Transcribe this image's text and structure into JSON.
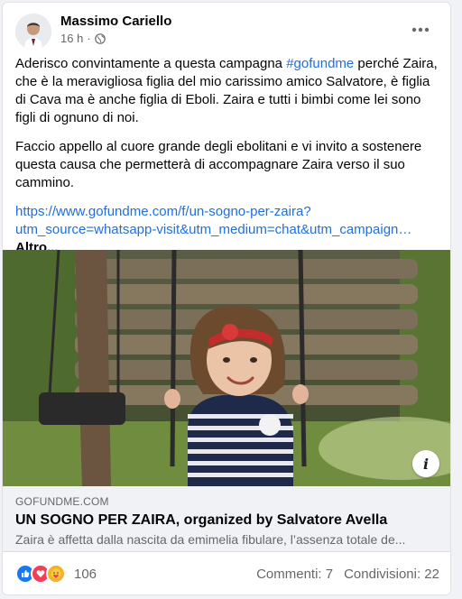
{
  "post": {
    "author": "Massimo Cariello",
    "time": "16 h",
    "paragraph1_before": "Aderisco convintamente a questa campagna ",
    "hashtag": "#gofundme",
    "paragraph1_after": " perché Zaira, che è la meravigliosa figlia del mio carissimo amico Salvatore, è figlia di Cava ma è anche figlia di Eboli. Zaira e tutti i bimbi come lei sono figli di ognuno di noi.",
    "paragraph2": "Faccio appello al cuore grande degli ebolitani e vi invito a sostenere questa causa che permetterà di accompagnare Zaira verso il suo cammino.",
    "url_line1": "https://www.gofundme.com/f/un-sogno-per-zaira?",
    "url_line2": "utm_source=whatsapp-visit&utm_medium=chat&utm_campaign…",
    "see_more": "Altro..."
  },
  "link_card": {
    "domain": "GOFUNDME.COM",
    "title": "UN SOGNO PER ZAIRA, organized by Salvatore Avella",
    "description": "Zaira è affetta dalla nascita da emimelia fibulare, l’assenza totale de..."
  },
  "stats": {
    "reactions_count": "106",
    "comments": "Commenti: 7",
    "shares": "Condivisioni: 22"
  },
  "icons": {
    "like": "#1877f2",
    "love": "#f33e58",
    "care": "#f7b125"
  }
}
